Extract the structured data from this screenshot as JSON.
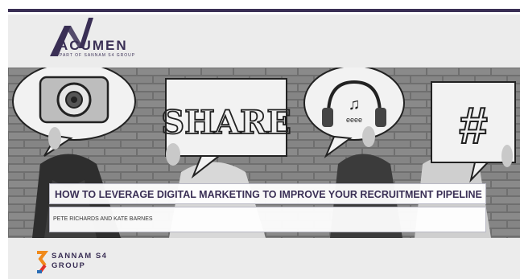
{
  "brand": {
    "name": "ACUMEN",
    "tagline": "PART OF SANNAM S4 GROUP",
    "accent": "#3a2f55"
  },
  "hero": {
    "signs": [
      "SHARE",
      "#"
    ],
    "image_desc_colors": {
      "brick": "#7a7a7a"
    }
  },
  "title": "HOW TO LEVERAGE DIGITAL MARKETING TO IMPROVE YOUR RECRUITMENT PIPELINE",
  "authors": "PETE RICHARDS AND KATE BARNES",
  "footer": {
    "line1": "SANNAM S4",
    "line2": "GROUP",
    "logo_colors": [
      "#f08a1c",
      "#e0312b",
      "#2a6db5"
    ]
  }
}
